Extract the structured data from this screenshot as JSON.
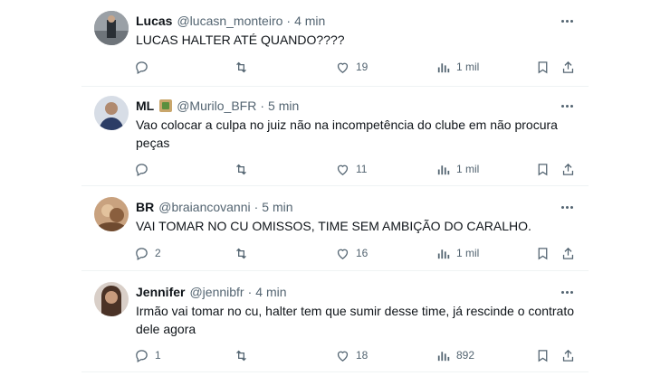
{
  "tweets": [
    {
      "name": "Lucas",
      "handle": "@lucasn_monteiro",
      "time": "4 min",
      "text": "LUCAS HALTER ATÉ QUANDO????",
      "replies": "",
      "retweets": "",
      "likes": "19",
      "views": "1 mil",
      "avatar_color": "#8a8f94"
    },
    {
      "name": "ML",
      "handle": "@Murilo_BFR",
      "time": "5 min",
      "text": "Vao colocar a culpa no juiz não na incompetência do clube em não procura peças",
      "replies": "",
      "retweets": "",
      "likes": "11",
      "views": "1 mil",
      "avatar_color": "#2c3d66"
    },
    {
      "name": "BR",
      "handle": "@braiancovanni",
      "time": "5 min",
      "text": "VAI TOMAR NO CU OMISSOS, TIME SEM AMBIÇÃO DO CARALHO.",
      "replies": "2",
      "retweets": "",
      "likes": "16",
      "views": "1 mil",
      "avatar_color": "#a07a58"
    },
    {
      "name": "Jennifer",
      "handle": "@jennibfr",
      "time": "4 min",
      "text": "Irmão vai tomar no cu, halter tem que sumir desse time, já rescinde o contrato dele agora",
      "replies": "1",
      "retweets": "",
      "likes": "18",
      "views": "892",
      "avatar_color": "#6b4f3f"
    }
  ],
  "separator": "·",
  "icons": [
    "reply-icon",
    "retweet-icon",
    "like-icon",
    "views-icon",
    "bookmark-icon",
    "share-icon",
    "more-icon"
  ]
}
